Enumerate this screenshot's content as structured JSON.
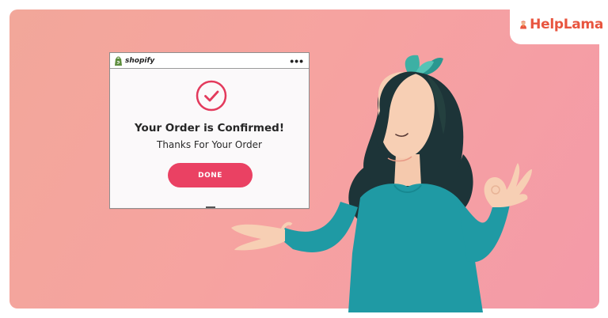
{
  "logo": {
    "text": "HelpLama",
    "icon": "monk-mascot-icon"
  },
  "window": {
    "brand": "shopify",
    "brand_icon": "shopify-bag-icon",
    "menu_icon": "more-dots-icon",
    "status_icon": "checkmark-circle-icon",
    "title": "Your Order is Confirmed!",
    "subtitle": "Thanks For Your Order",
    "done_label": "DONE"
  },
  "colors": {
    "background": "#f4a0a2",
    "accent": "#ea4163",
    "logo": "#e8553f",
    "teal": "#1f9aa4"
  }
}
